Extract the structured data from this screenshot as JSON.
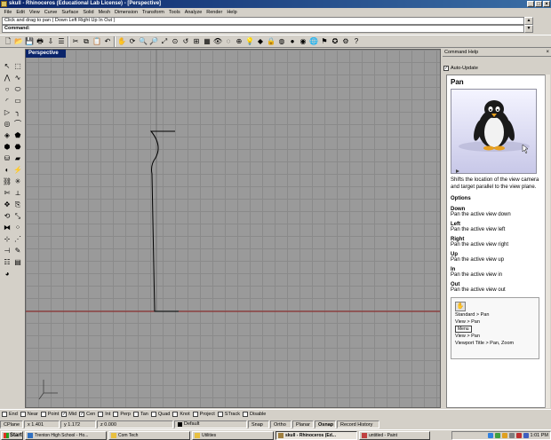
{
  "window": {
    "title": "skull - Rhinoceros (Educational Lab License) - [Perspective]",
    "controls": [
      "_",
      "□",
      "×"
    ]
  },
  "menu": [
    "File",
    "Edit",
    "View",
    "Curve",
    "Surface",
    "Solid",
    "Mesh",
    "Dimension",
    "Transform",
    "Tools",
    "Analyze",
    "Render",
    "Help"
  ],
  "command": {
    "history": "Click and drag to pan ( Down  Left  Right  Up  In  Out )",
    "prompt_label": "Command:",
    "prompt_value": ""
  },
  "viewport": {
    "tab_label": "Perspective"
  },
  "help_panel": {
    "title": "Command Help",
    "auto_update_label": "Auto-Update",
    "auto_update_checked": true,
    "command_name": "Pan",
    "description": "Shifts the location of the view camera and target parallel to the view plane.",
    "options_heading": "Options",
    "options": [
      {
        "name": "Down",
        "desc": "Pan the active view down"
      },
      {
        "name": "Left",
        "desc": "Pan the active view left"
      },
      {
        "name": "Right",
        "desc": "Pan the active view right"
      },
      {
        "name": "Up",
        "desc": "Pan the active view up"
      },
      {
        "name": "In",
        "desc": "Pan the active view in"
      },
      {
        "name": "Out",
        "desc": "Pan the active view out"
      }
    ],
    "access": {
      "line1": "Standard > Pan",
      "line2": "View > Pan",
      "menu_button": "Menu",
      "line3": "View > Pan",
      "line4": "Viewport Title > Pan, Zoom"
    }
  },
  "osnap": [
    {
      "label": "End",
      "checked": false
    },
    {
      "label": "Near",
      "checked": false
    },
    {
      "label": "Point",
      "checked": false
    },
    {
      "label": "Mid",
      "checked": true
    },
    {
      "label": "Cen",
      "checked": true
    },
    {
      "label": "Int",
      "checked": false
    },
    {
      "label": "Perp",
      "checked": false
    },
    {
      "label": "Tan",
      "checked": false
    },
    {
      "label": "Quad",
      "checked": false
    },
    {
      "label": "Knot",
      "checked": false
    },
    {
      "label": "Project",
      "checked": false
    },
    {
      "label": "STrack",
      "checked": false
    },
    {
      "label": "Disable",
      "checked": false
    }
  ],
  "status": {
    "cplane": "CPlane",
    "x": "x 1.401",
    "y": "y 1.172",
    "z": "z 0.000",
    "layer": "Default",
    "snap": "Snap",
    "ortho": "Ortho",
    "planar": "Planar",
    "osnap": "Osnap",
    "record_history": "Record History"
  },
  "taskbar": {
    "start": "Start",
    "tasks": [
      {
        "label": "Trenton High School - Ho...",
        "active": false
      },
      {
        "label": "Com Tech",
        "active": false
      },
      {
        "label": "Utilities",
        "active": false
      },
      {
        "label": "skull - Rhinoceros (Ed...",
        "active": true
      },
      {
        "label": "untitled - Paint",
        "active": false
      }
    ],
    "clock": "1:01 PM"
  },
  "colors": {
    "titlebar": "#0a246a",
    "viewport_bg": "#9a9a9a",
    "x_axis": "#8b1a1a",
    "curve": "#000000"
  }
}
